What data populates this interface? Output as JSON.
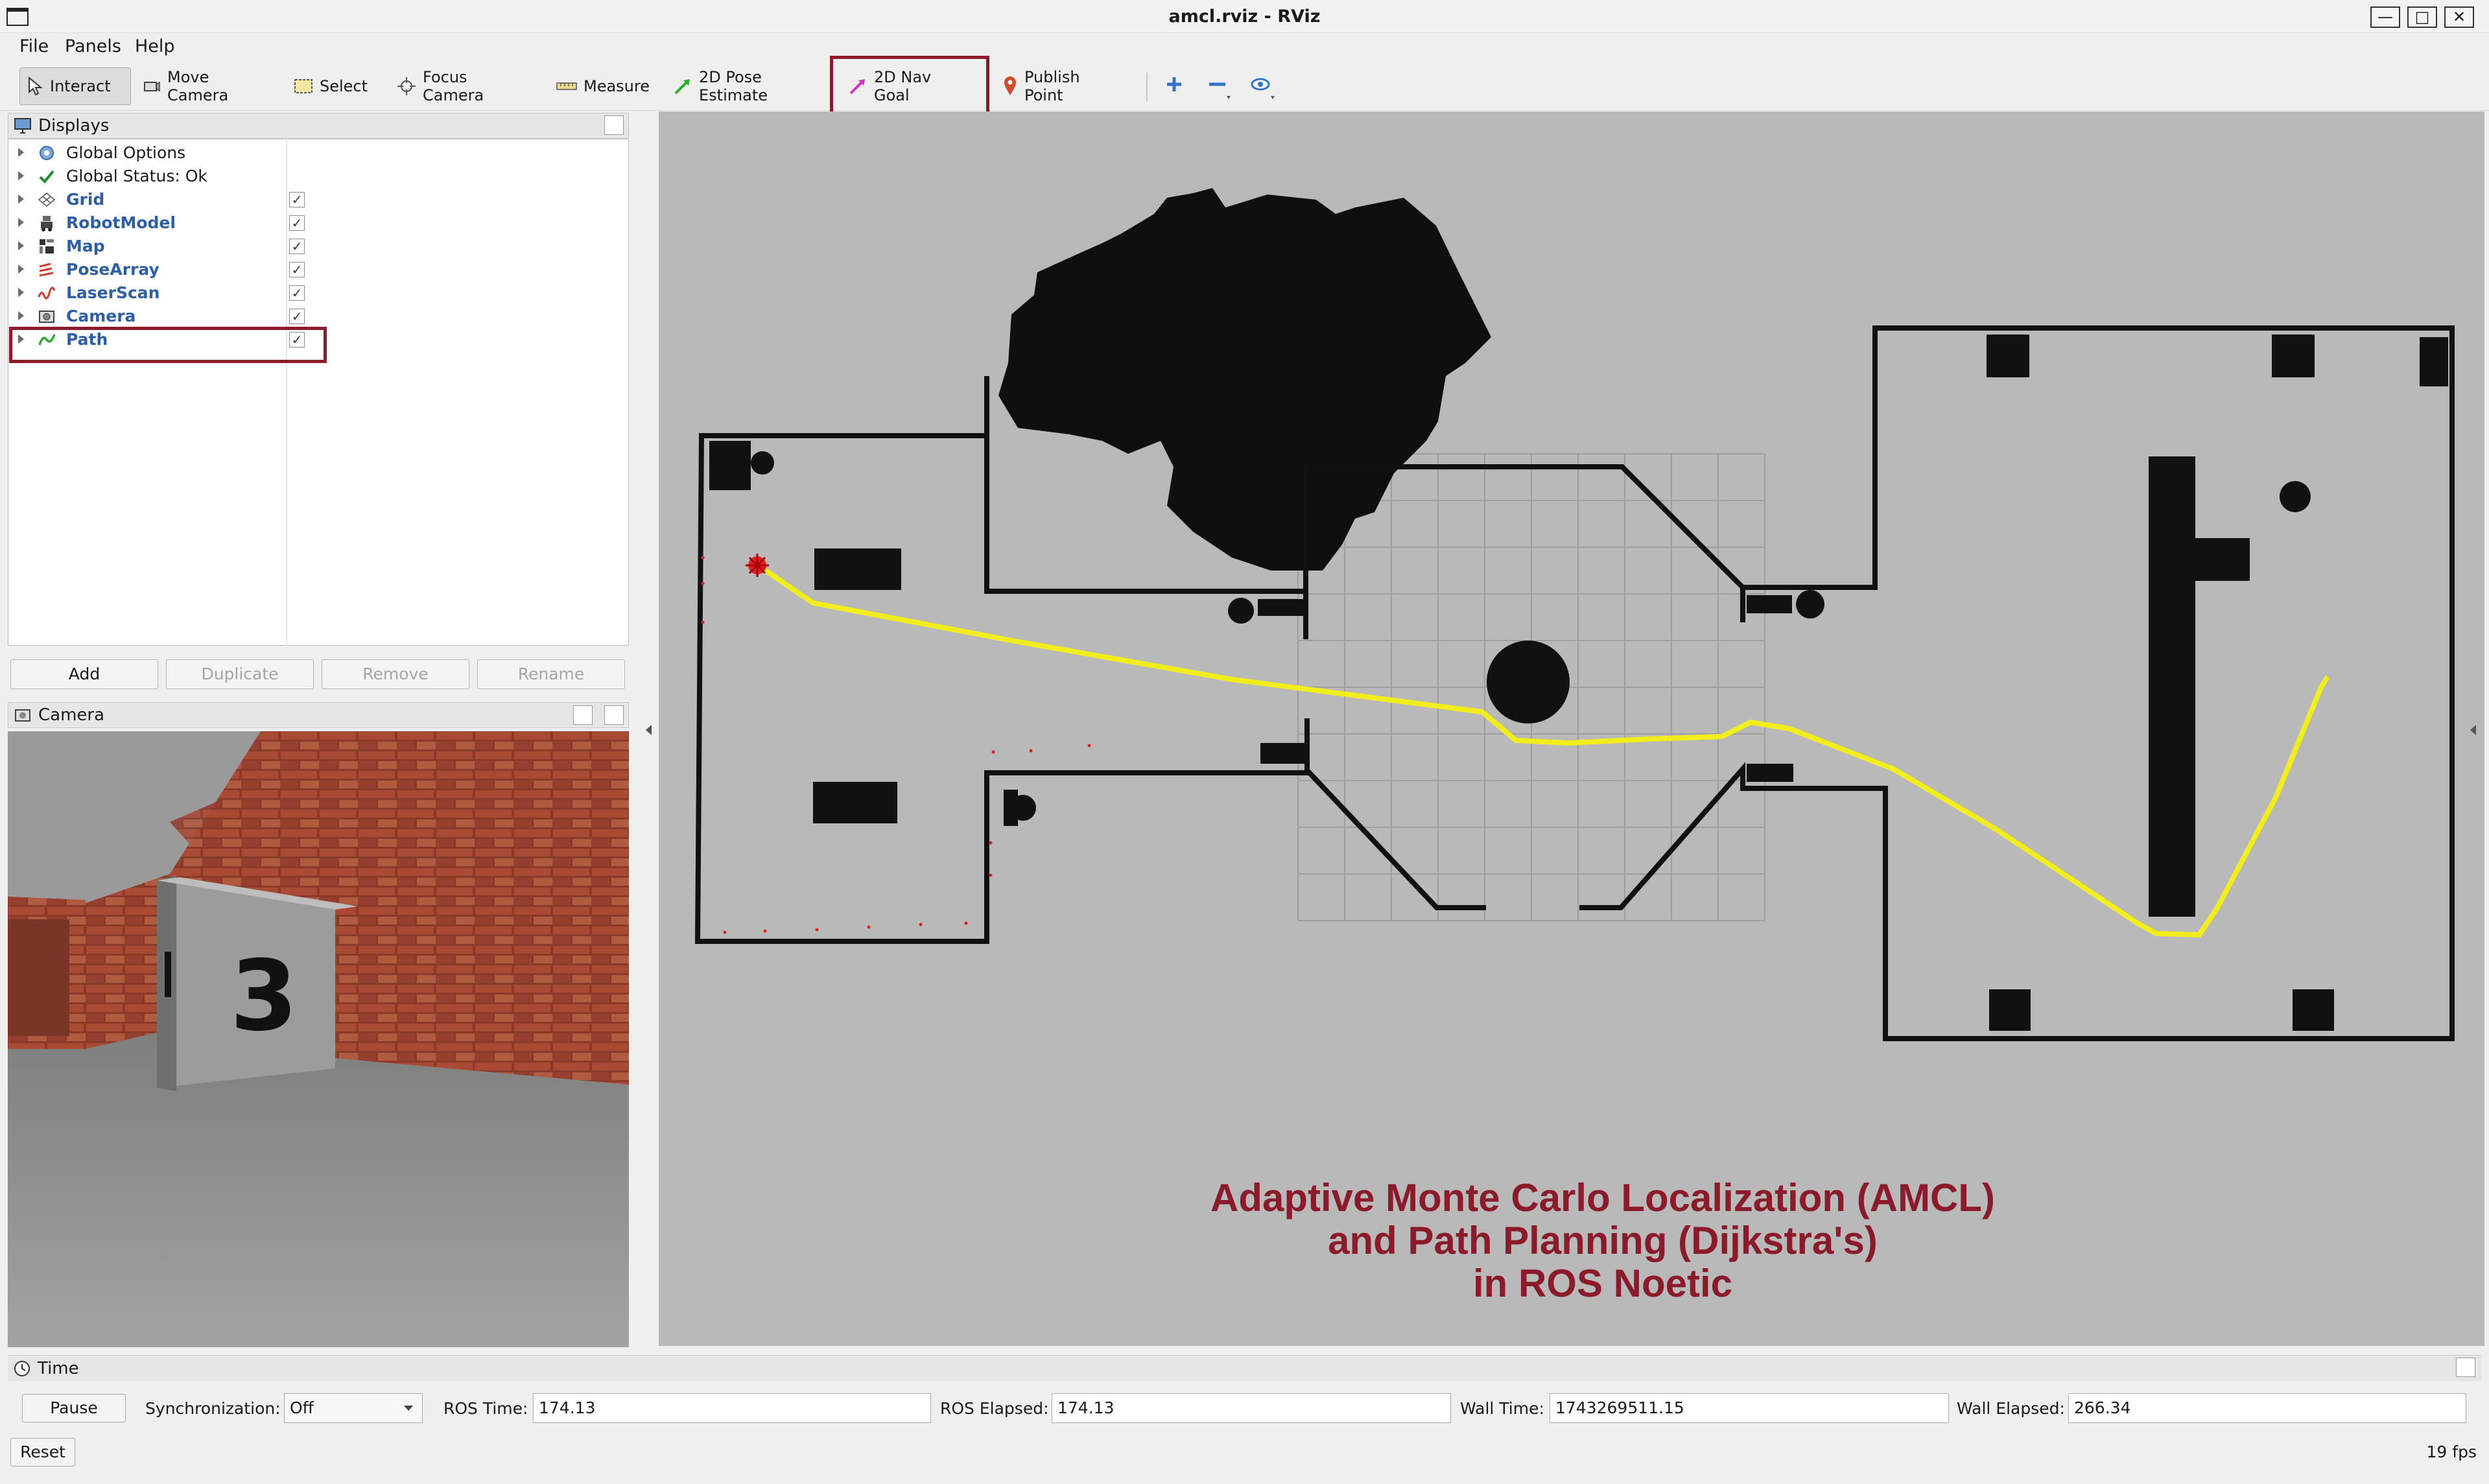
{
  "window": {
    "title": "amcl.rviz - RViz",
    "controls": [
      "minimize-icon",
      "maximize-icon",
      "close-icon"
    ]
  },
  "menu": [
    {
      "label": "File"
    },
    {
      "label": "Panels"
    },
    {
      "label": "Help"
    }
  ],
  "toolbar": {
    "tools": [
      {
        "label": "Interact",
        "icon": "cursor-icon",
        "active": true
      },
      {
        "label": "Move Camera",
        "icon": "move-camera-icon"
      },
      {
        "label": "Select",
        "icon": "select-box-icon"
      },
      {
        "label": "Focus Camera",
        "icon": "focus-camera-icon"
      },
      {
        "label": "Measure",
        "icon": "ruler-icon"
      },
      {
        "label": "2D Pose Estimate",
        "icon": "green-arrow-icon"
      },
      {
        "label": "2D Nav Goal",
        "icon": "magenta-arrow-icon",
        "highlighted": true
      },
      {
        "label": "Publish Point",
        "icon": "map-pin-icon"
      }
    ],
    "extra_icons": [
      "add-tool-icon",
      "remove-tool-icon",
      "view-eye-icon"
    ]
  },
  "displays": {
    "title": "Displays",
    "items": [
      {
        "label": "Global Options",
        "checked": null,
        "style": "plain",
        "icon": "gear-icon"
      },
      {
        "label": "Global Status: Ok",
        "checked": null,
        "style": "plain",
        "icon": "checkmark-icon"
      },
      {
        "label": "Grid",
        "checked": true,
        "style": "blue",
        "icon": "grid-icon"
      },
      {
        "label": "RobotModel",
        "checked": true,
        "style": "blue",
        "icon": "robot-icon"
      },
      {
        "label": "Map",
        "checked": true,
        "style": "blue",
        "icon": "map-icon"
      },
      {
        "label": "PoseArray",
        "checked": true,
        "style": "blue",
        "icon": "pose-array-icon"
      },
      {
        "label": "LaserScan",
        "checked": true,
        "style": "blue",
        "icon": "laser-scan-icon"
      },
      {
        "label": "Camera",
        "checked": true,
        "style": "blue",
        "icon": "camera-icon"
      },
      {
        "label": "Path",
        "checked": true,
        "style": "blue",
        "icon": "path-icon",
        "highlighted": true
      }
    ],
    "check_mark": "✓",
    "buttons": {
      "add": "Add",
      "duplicate": "Duplicate",
      "remove": "Remove",
      "rename": "Rename"
    }
  },
  "camera": {
    "title": "Camera",
    "box_number": "3"
  },
  "viewport": {
    "caption": [
      "Adaptive Monte Carlo Localization (AMCL)",
      "and Path Planning (Dijkstra's)",
      "in ROS Noetic"
    ],
    "path_color": "#f2ee1b",
    "highlight_color": "#8b1a2b"
  },
  "time": {
    "title": "Time",
    "pause": "Pause",
    "sync_label": "Synchronization:",
    "sync_value": "Off",
    "ros_time_label": "ROS Time:",
    "ros_time": "174.13",
    "ros_elapsed_label": "ROS Elapsed:",
    "ros_elapsed": "174.13",
    "wall_time_label": "Wall Time:",
    "wall_time": "1743269511.15",
    "wall_elapsed_label": "Wall Elapsed:",
    "wall_elapsed": "266.34",
    "reset": "Reset",
    "fps": "19 fps"
  }
}
